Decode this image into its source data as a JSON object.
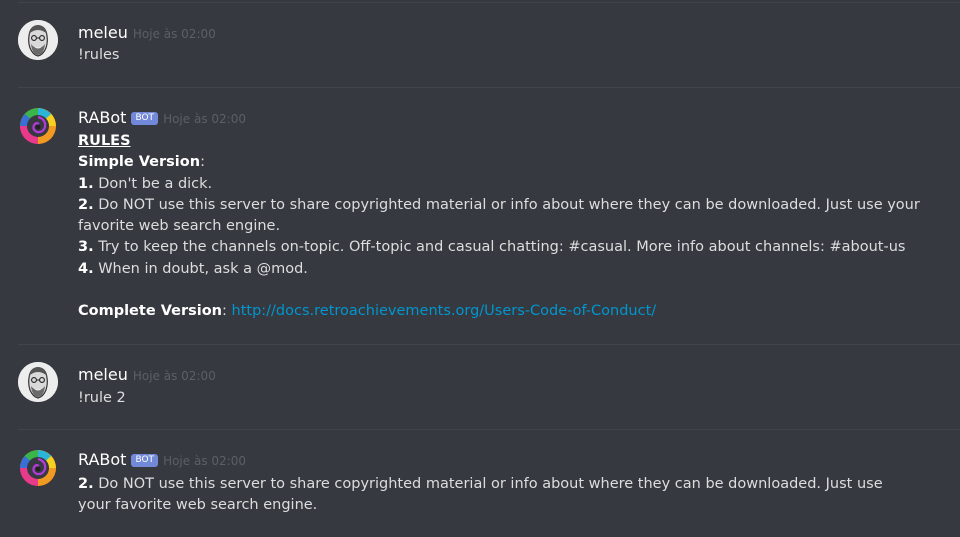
{
  "messages": [
    {
      "username": "meleu",
      "timestamp": "Hoje às 02:00",
      "text": "!rules"
    },
    {
      "username": "RABot",
      "bot_tag": "BOT",
      "timestamp": "Hoje às 02:00",
      "rules_heading": "RULES",
      "simple_version_label": "Simple Version",
      "simple_version_colon": ":",
      "rules": [
        {
          "num": "1.",
          "text": " Don't be a dick."
        },
        {
          "num": "2.",
          "text": " Do NOT use this server to share copyrighted material or info about where they can be downloaded. Just use your favorite web search engine."
        },
        {
          "num": "3.",
          "text": " Try to keep the channels on-topic. Off-topic and casual chatting: #casual. More info about channels: #about-us"
        },
        {
          "num": "4.",
          "text": " When in doubt, ask a @mod."
        }
      ],
      "complete_version_label": "Complete Version",
      "complete_version_colon": ": ",
      "complete_version_link": "http://docs.retroachievements.org/Users-Code-of-Conduct/"
    },
    {
      "username": "meleu",
      "timestamp": "Hoje às 02:00",
      "text": "!rule 2"
    },
    {
      "username": "RABot",
      "bot_tag": "BOT",
      "timestamp": "Hoje às 02:00",
      "rule_num": "2.",
      "rule_text": " Do NOT use this server to share copyrighted material or info about where they can be downloaded. Just use your favorite web search engine."
    }
  ],
  "colors": {
    "background": "#36393f",
    "text": "#dcddde",
    "username": "#ffffff",
    "timestamp": "#5c5f66",
    "bot_tag": "#7289da",
    "link": "#0096cf",
    "divider": "#40444b"
  },
  "icons": {
    "user_avatar": "bearded-man-sketch-avatar",
    "bot_avatar": "rainbow-swirl-avatar"
  }
}
